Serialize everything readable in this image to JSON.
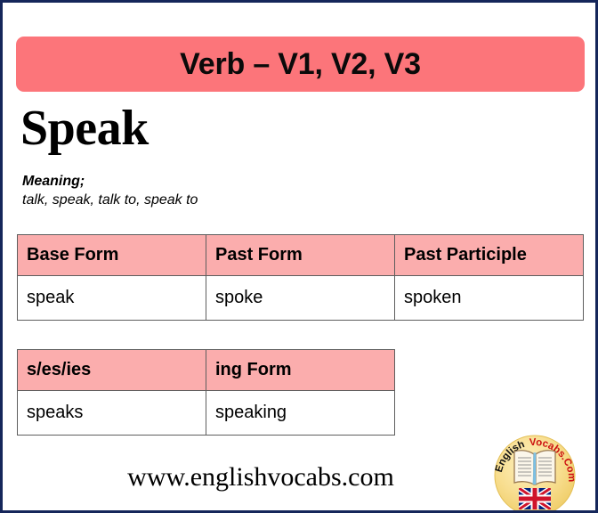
{
  "page": {
    "border_color": "#15265a",
    "background": "#ffffff"
  },
  "banner": {
    "label": "Verb – V1, V2, V3",
    "background": "#fc757a",
    "text_color": "#0a0a0a"
  },
  "verb": {
    "title": "Speak",
    "meaning_label": "Meaning;",
    "meaning_value": "talk, speak, talk to, speak to"
  },
  "tables": {
    "forms": {
      "header_background": "#fbadad",
      "headers": [
        "Base Form",
        "Past Form",
        "Past Participle"
      ],
      "rows": [
        [
          "speak",
          "spoke",
          "spoken"
        ]
      ]
    },
    "inflections": {
      "header_background": "#fbadad",
      "headers": [
        "s/es/ies",
        "ing Form"
      ],
      "rows": [
        [
          "speaks",
          "speaking"
        ]
      ]
    }
  },
  "footer": {
    "url": "www.englishvocabs.com"
  },
  "logo": {
    "name": "englishvocabs-logo",
    "text_primary": "English",
    "text_secondary": "Vocabs.Com",
    "primary_color": "#111111",
    "secondary_color": "#cc1111",
    "circle_color": "#f7dd8c",
    "book_icon": "open-book-icon",
    "flag_icon": "uk-flag-icon"
  }
}
